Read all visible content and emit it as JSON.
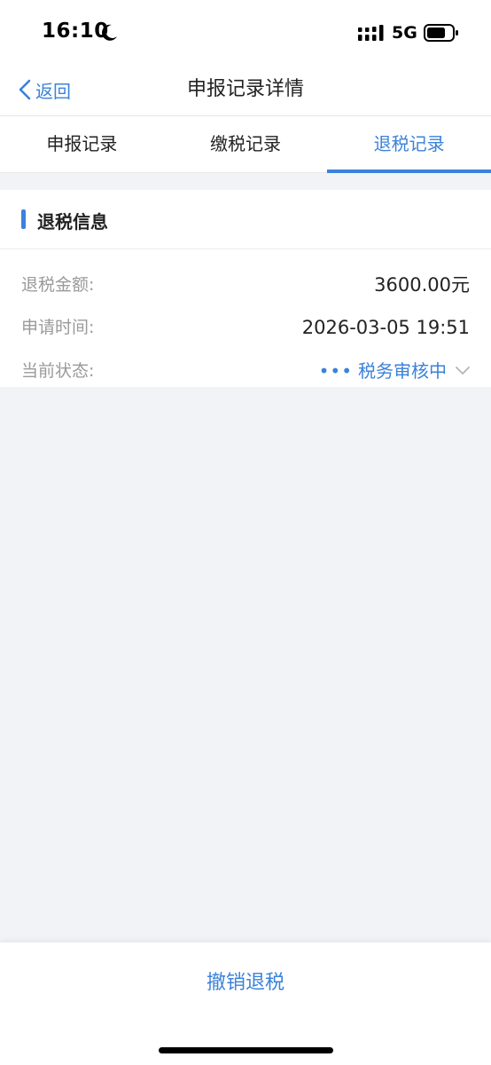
{
  "status_bar": {
    "time": "16:10",
    "network": "5G",
    "icons": [
      "moon-icon",
      "signal-icon",
      "battery-icon"
    ]
  },
  "nav": {
    "back_label": "返回",
    "title": "申报记录详情"
  },
  "tabs": [
    {
      "label": "申报记录",
      "active": false
    },
    {
      "label": "缴税记录",
      "active": false
    },
    {
      "label": "退税记录",
      "active": true
    }
  ],
  "section": {
    "title": "退税信息"
  },
  "fields": {
    "amount": {
      "label": "退税金额:",
      "value": "3600.00元"
    },
    "apply_time": {
      "label": "申请时间:",
      "value": "2026-03-05 19:51"
    },
    "status": {
      "label": "当前状态:",
      "value": "税务审核中",
      "dots": "•••"
    }
  },
  "bottom": {
    "cancel_label": "撤销退税"
  },
  "colors": {
    "accent": "#3b82d9",
    "background": "#f2f3f7",
    "label_gray": "#9a9a9a"
  }
}
